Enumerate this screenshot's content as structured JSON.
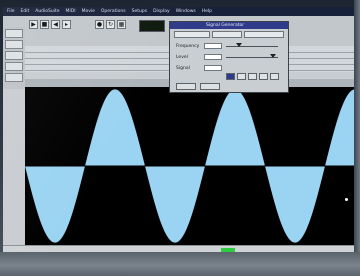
{
  "menubar": {
    "items": [
      "File",
      "Edit",
      "AudioSuite",
      "MIDI",
      "Movie",
      "Operations",
      "Setups",
      "Display",
      "Windows",
      "Help"
    ]
  },
  "dialog": {
    "title": "Signal Generator",
    "tabs": [
      "",
      "",
      ""
    ],
    "rows": [
      {
        "label": "Frequency",
        "value": ""
      },
      {
        "label": "Level",
        "value": ""
      },
      {
        "label": "Signal",
        "value": ""
      }
    ],
    "buttons": [
      "",
      ""
    ]
  },
  "toolbar": {
    "counter": "",
    "icons": [
      "play-icon",
      "stop-icon",
      "rewind-icon",
      "forward-icon",
      "record-icon",
      "loop-icon"
    ]
  },
  "colors": {
    "waveform": "#9bd4f2",
    "waveform_bg": "#000000",
    "menubar_bg": "#18213a",
    "dialog_title_bg": "#2f3b8a",
    "status_indicator": "#2ecc40"
  },
  "waveform": {
    "visible_cycles": 2.75,
    "peak_level": 0.97
  }
}
